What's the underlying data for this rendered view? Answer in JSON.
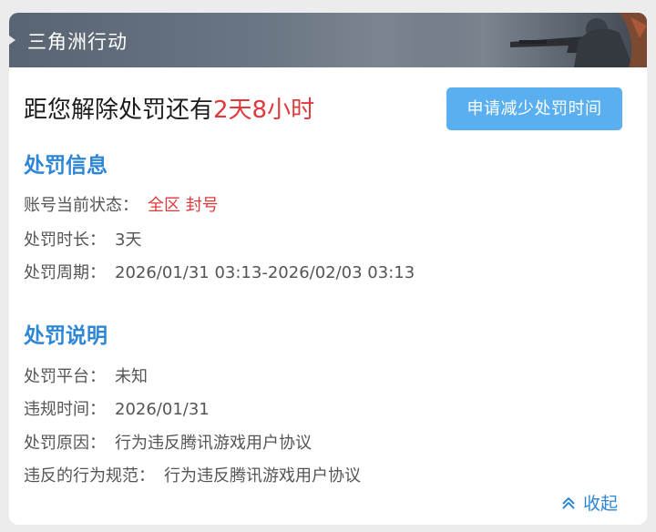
{
  "banner": {
    "title": "三角洲行动"
  },
  "headline": {
    "prefix": "距您解除处罚还有",
    "remaining": "2天8小时"
  },
  "reduce_button": {
    "label": "申请减少处罚时间"
  },
  "penalty_info": {
    "title": "处罚信息",
    "status_label": "账号当前状态：",
    "status_value": "全区 封号",
    "duration_label": "处罚时长：",
    "duration_value": "3天",
    "period_label": "处罚周期：",
    "period_value": "2026/01/31 03:13-2026/02/03 03:13"
  },
  "penalty_desc": {
    "title": "处罚说明",
    "platform_label": "处罚平台：",
    "platform_value": "未知",
    "violation_time_label": "违规时间：",
    "violation_time_value": "2026/01/31",
    "reason_label": "处罚原因：",
    "reason_value": "行为违反腾讯游戏用户协议",
    "rule_label": "违反的行为规范：",
    "rule_value": "行为违反腾讯游戏用户协议"
  },
  "collapse": {
    "label": "收起",
    "icon": "double-chevron-up-icon"
  },
  "colors": {
    "accent": "#2d86d6",
    "button": "#5aaff0",
    "danger": "#e0393b"
  }
}
